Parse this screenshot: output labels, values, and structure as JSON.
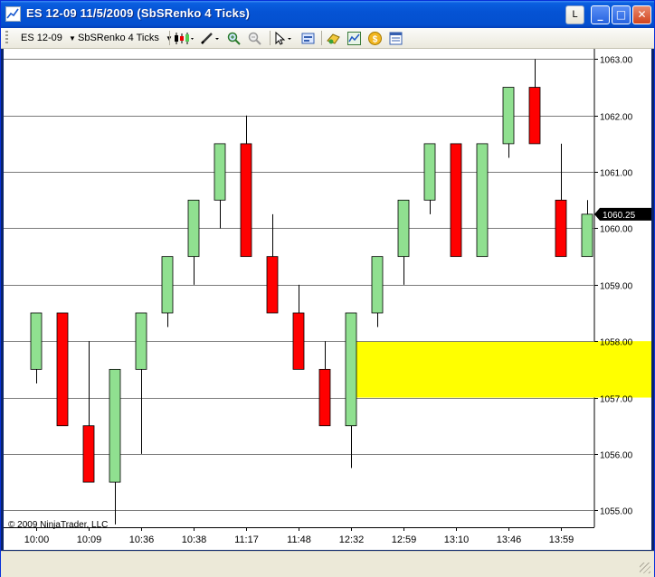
{
  "window": {
    "title": "ES 12-09  11/5/2009 (SbSRenko 4 Ticks)",
    "buttons": {
      "l": "L",
      "minimize": "_",
      "maximize": "□",
      "close": "✕"
    }
  },
  "toolbar": {
    "instrument": "ES 12-09",
    "bar_type": "SbSRenko 4 Ticks",
    "icons": [
      "candlestick-icon",
      "pencil-icon",
      "zoom-in-icon",
      "zoom-out-icon",
      "pointer-icon",
      "data-box-icon",
      "strategy-icon",
      "indicator-icon",
      "dollar-icon",
      "properties-icon"
    ]
  },
  "colors": {
    "up": "#90e090",
    "down": "#ff0000",
    "zone": "#ffff00",
    "grid": "#7a7a7a"
  },
  "chart_data": {
    "type": "candlestick",
    "copyright": "© 2009 NinjaTrader, LLC",
    "last_price_label": "1060.25",
    "last_price": 1060.25,
    "ylim": [
      1054.7,
      1063.15
    ],
    "y_ticks": [
      1055.0,
      1056.0,
      1057.0,
      1058.0,
      1059.0,
      1060.0,
      1061.0,
      1062.0,
      1063.0
    ],
    "y_tick_labels": [
      "1055.00",
      "1056.00",
      "1057.00",
      "1058.00",
      "1059.00",
      "1060.00",
      "1061.00",
      "1062.00",
      "1063.00"
    ],
    "x_tick_labels": [
      {
        "bar": 0,
        "label": "10:00"
      },
      {
        "bar": 2,
        "label": "10:09"
      },
      {
        "bar": 4,
        "label": "10:36"
      },
      {
        "bar": 6,
        "label": "10:38"
      },
      {
        "bar": 8,
        "label": "11:17"
      },
      {
        "bar": 10,
        "label": "11:48"
      },
      {
        "bar": 12,
        "label": "12:32"
      },
      {
        "bar": 14,
        "label": "12:59"
      },
      {
        "bar": 16,
        "label": "13:10"
      },
      {
        "bar": 18,
        "label": "13:46"
      },
      {
        "bar": 20,
        "label": "13:59"
      }
    ],
    "zone": {
      "low": 1057.0,
      "high": 1058.0,
      "from_bar": 12
    },
    "bars": [
      {
        "open": 1057.5,
        "high": 1058.5,
        "low": 1057.25,
        "close": 1058.5
      },
      {
        "open": 1058.5,
        "high": 1058.5,
        "low": 1056.5,
        "close": 1056.5
      },
      {
        "open": 1056.5,
        "high": 1058.0,
        "low": 1055.5,
        "close": 1055.5
      },
      {
        "open": 1055.5,
        "high": 1057.5,
        "low": 1054.75,
        "close": 1057.5
      },
      {
        "open": 1057.5,
        "high": 1058.5,
        "low": 1056.0,
        "close": 1058.5
      },
      {
        "open": 1058.5,
        "high": 1059.5,
        "low": 1058.25,
        "close": 1059.5
      },
      {
        "open": 1059.5,
        "high": 1060.5,
        "low": 1059.0,
        "close": 1060.5
      },
      {
        "open": 1060.5,
        "high": 1061.5,
        "low": 1060.0,
        "close": 1061.5
      },
      {
        "open": 1061.5,
        "high": 1062.0,
        "low": 1059.5,
        "close": 1059.5
      },
      {
        "open": 1059.5,
        "high": 1060.25,
        "low": 1058.5,
        "close": 1058.5
      },
      {
        "open": 1058.5,
        "high": 1059.0,
        "low": 1057.5,
        "close": 1057.5
      },
      {
        "open": 1057.5,
        "high": 1058.0,
        "low": 1056.5,
        "close": 1056.5
      },
      {
        "open": 1056.5,
        "high": 1058.5,
        "low": 1055.75,
        "close": 1058.5
      },
      {
        "open": 1058.5,
        "high": 1059.5,
        "low": 1058.25,
        "close": 1059.5
      },
      {
        "open": 1059.5,
        "high": 1060.5,
        "low": 1059.0,
        "close": 1060.5
      },
      {
        "open": 1060.5,
        "high": 1061.5,
        "low": 1060.25,
        "close": 1061.5
      },
      {
        "open": 1061.5,
        "high": 1061.5,
        "low": 1059.5,
        "close": 1059.5
      },
      {
        "open": 1059.5,
        "high": 1061.5,
        "low": 1059.5,
        "close": 1061.5
      },
      {
        "open": 1061.5,
        "high": 1062.5,
        "low": 1061.25,
        "close": 1062.5
      },
      {
        "open": 1062.5,
        "high": 1063.0,
        "low": 1061.5,
        "close": 1061.5
      },
      {
        "open": 1060.5,
        "high": 1061.5,
        "low": 1059.5,
        "close": 1059.5
      },
      {
        "open": 1059.5,
        "high": 1060.5,
        "low": 1059.5,
        "close": 1060.25
      }
    ]
  }
}
